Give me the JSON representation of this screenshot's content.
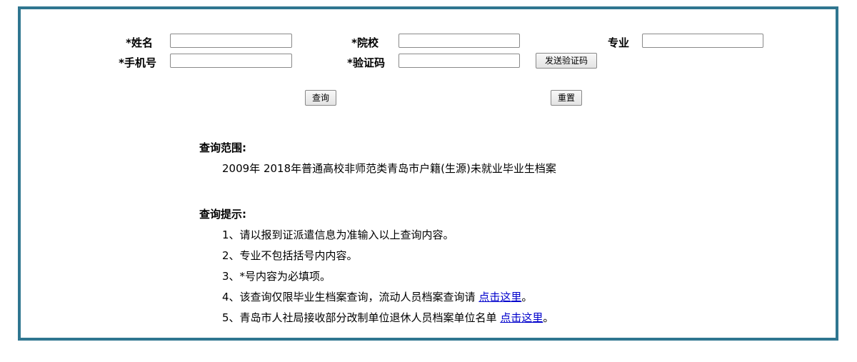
{
  "form": {
    "name_label": "*姓名",
    "school_label": "*院校",
    "major_label": "专业",
    "phone_label": "*手机号",
    "code_label": "*验证码",
    "name_value": "",
    "school_value": "",
    "major_value": "",
    "phone_value": "",
    "code_value": "",
    "send_code_label": "发送验证码",
    "query_label": "查询",
    "reset_label": "重置"
  },
  "scope": {
    "title": "查询范围:",
    "text": "2009年 2018年普通高校非师范类青岛市户籍(生源)未就业毕业生档案"
  },
  "tips": {
    "title": "查询提示:",
    "items": [
      {
        "text": "1、请以报到证派遣信息为准输入以上查询内容。"
      },
      {
        "text": "2、专业不包括括号内内容。"
      },
      {
        "text": "3、*号内容为必填项。"
      },
      {
        "text": "4、该查询仅限毕业生档案查询，流动人员档案查询请 ",
        "link": "点击这里",
        "suffix": "。"
      },
      {
        "text": "5、青岛市人社局接收部分改制单位退休人员档案单位名单 ",
        "link": "点击这里",
        "suffix": "。"
      }
    ]
  }
}
